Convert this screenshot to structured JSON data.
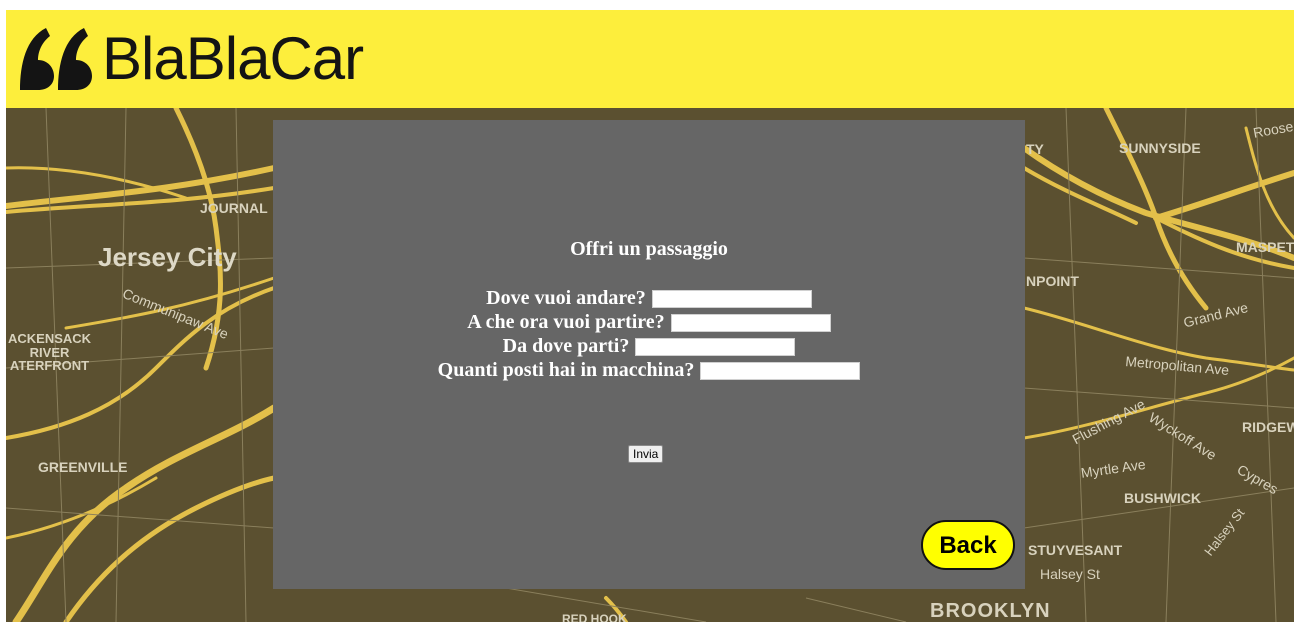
{
  "header": {
    "brand": "BlaBlaCar",
    "background_color": "#fdee3c",
    "logo_icon": "blablacar-quote-mark-icon"
  },
  "map": {
    "background_color": "#5b5030",
    "road_color": "#e3c04a",
    "labels": {
      "journal": "JOURNAL",
      "jersey_city": "Jersey City",
      "communipaw": "Communipaw Ave",
      "hackensack": "ACKENSACK\nRIVER\nATERFRONT",
      "greenville": "GREENVILLE",
      "sunnyside": "SUNNYSIDE",
      "roose": "Roose",
      "ty": "TY",
      "maspeth": "MASPETH",
      "npoint": "NPOINT",
      "grand_ave": "Grand Ave",
      "metropolitan": "Metropolitan Ave",
      "flushing": "Flushing Ave",
      "wyckoff": "Wyckoff Ave",
      "ridgew": "RIDGEW",
      "myrtle": "Myrtle Ave",
      "cypress": "Cypres",
      "bushwick": "BUSHWICK",
      "halsey_st_diag": "Halsey St",
      "stuyvesant": "STUYVESANT",
      "halsey_st": "Halsey St",
      "brooklyn": "BROOKLYN",
      "red_hook": "RED HOOK"
    }
  },
  "form": {
    "title": "Offri un passaggio",
    "fields": [
      {
        "label": "Dove vuoi andare?",
        "value": ""
      },
      {
        "label": "A che ora vuoi partire?",
        "value": ""
      },
      {
        "label": "Da dove parti?",
        "value": ""
      },
      {
        "label": "Quanti posti hai in macchina?",
        "value": ""
      }
    ],
    "submit_label": "Invia"
  },
  "back_button": {
    "label": "Back",
    "color": "#ffff00"
  }
}
